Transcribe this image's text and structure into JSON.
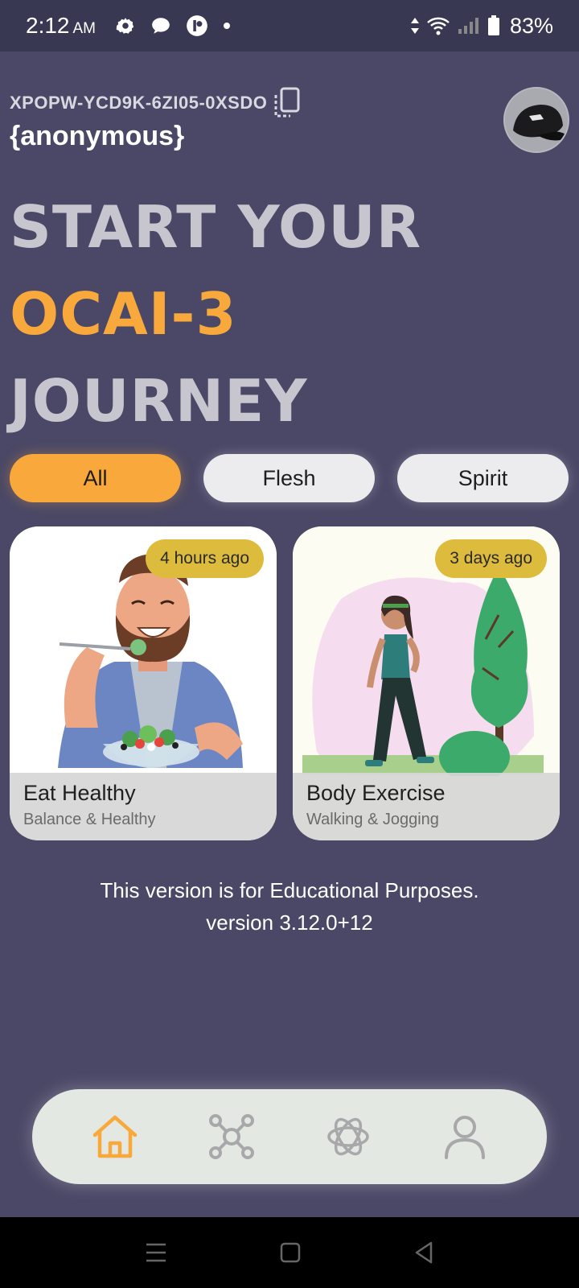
{
  "status_bar": {
    "time": "2:12",
    "ampm": "AM",
    "battery": "83%"
  },
  "header": {
    "user_code": "XPOPW-YCD9K-6ZI05-0XSDO",
    "username": "{anonymous}"
  },
  "hero": {
    "line1": "START YOUR",
    "line2": "OCAI-3",
    "line3": "JOURNEY"
  },
  "filters": [
    {
      "label": "All",
      "active": true
    },
    {
      "label": "Flesh",
      "active": false
    },
    {
      "label": "Spirit",
      "active": false
    }
  ],
  "cards": [
    {
      "badge": "4 hours ago",
      "title": "Eat Healthy",
      "subtitle": "Balance & Healthy"
    },
    {
      "badge": "3 days ago",
      "title": "Body Exercise",
      "subtitle": "Walking & Jogging"
    }
  ],
  "notes": {
    "line1": "This version is for Educational Purposes.",
    "line2": "version 3.12.0+12"
  },
  "bottom_nav": [
    {
      "icon": "home-icon",
      "active": true
    },
    {
      "icon": "network-icon",
      "active": false
    },
    {
      "icon": "ai-icon",
      "active": false
    },
    {
      "icon": "profile-icon",
      "active": false
    }
  ],
  "colors": {
    "background": "#4a4866",
    "accent": "#f9a93b",
    "badge": "#ddbb3c",
    "chip_inactive": "#ececee",
    "nav_bg": "#e3e8e2",
    "icon_inactive": "#a8a8aa"
  }
}
